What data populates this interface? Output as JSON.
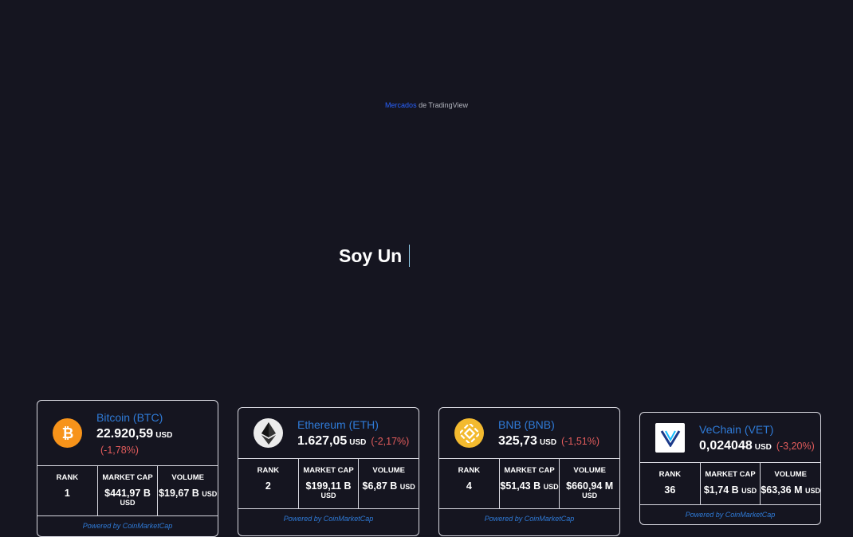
{
  "tradingview": {
    "link_text": "Mercados",
    "suffix_text": "de TradingView"
  },
  "hero": {
    "text": "Soy Un"
  },
  "cards": [
    {
      "name": "Bitcoin (BTC)",
      "price": "22.920,59",
      "currency": "USD",
      "change": "(-1,78%)",
      "rank_label": "RANK",
      "rank": "1",
      "market_cap_label": "MARKET CAP",
      "market_cap": "$441,97 B",
      "market_cap_unit": "USD",
      "volume_label": "VOLUME",
      "volume": "$19,67 B",
      "volume_unit": "USD",
      "footer": "Powered by CoinMarketCap",
      "icon": "bitcoin-icon",
      "icon_color": "#f7931a"
    },
    {
      "name": "Ethereum (ETH)",
      "price": "1.627,05",
      "currency": "USD",
      "change": "(-2,17%)",
      "rank_label": "RANK",
      "rank": "2",
      "market_cap_label": "MARKET CAP",
      "market_cap": "$199,11 B",
      "market_cap_unit": "USD",
      "volume_label": "VOLUME",
      "volume": "$6,87 B",
      "volume_unit": "USD",
      "footer": "Powered by CoinMarketCap",
      "icon": "ethereum-icon",
      "icon_color": "#ececec"
    },
    {
      "name": "BNB (BNB)",
      "price": "325,73",
      "currency": "USD",
      "change": "(-1,51%)",
      "rank_label": "RANK",
      "rank": "4",
      "market_cap_label": "MARKET CAP",
      "market_cap": "$51,43 B",
      "market_cap_unit": "USD",
      "volume_label": "VOLUME",
      "volume": "$660,94 M",
      "volume_unit": "USD",
      "footer": "Powered by CoinMarketCap",
      "icon": "bnb-icon",
      "icon_color": "#f3ba2f"
    },
    {
      "name": "VeChain (VET)",
      "price": "0,024048",
      "currency": "USD",
      "change": "(-3,20%)",
      "rank_label": "RANK",
      "rank": "36",
      "market_cap_label": "MARKET CAP",
      "market_cap": "$1,74 B",
      "market_cap_unit": "USD",
      "volume_label": "VOLUME",
      "volume": "$63,36 M",
      "volume_unit": "USD",
      "footer": "Powered by CoinMarketCap",
      "icon": "vechain-icon",
      "icon_color": "#15bdff"
    }
  ],
  "colors": {
    "background": "#151520",
    "link_blue": "#2f7bd8",
    "negative": "#e35c5c"
  }
}
